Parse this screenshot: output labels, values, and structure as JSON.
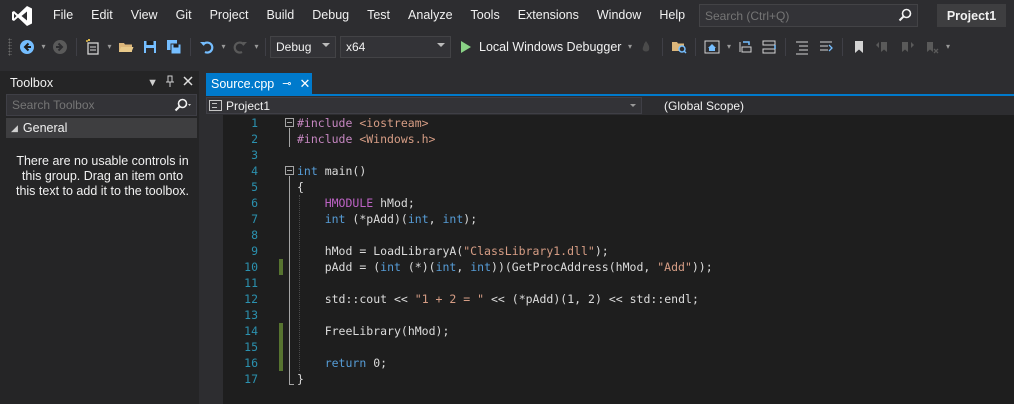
{
  "menu": {
    "items": [
      "File",
      "Edit",
      "View",
      "Git",
      "Project",
      "Build",
      "Debug",
      "Test",
      "Analyze",
      "Tools",
      "Extensions",
      "Window",
      "Help"
    ],
    "search_placeholder": "Search (Ctrl+Q)",
    "project_name": "Project1"
  },
  "toolbar": {
    "configuration": "Debug",
    "platform": "x64",
    "debugger_label": "Local Windows Debugger"
  },
  "toolbox": {
    "title": "Toolbox",
    "search_placeholder": "Search Toolbox",
    "group": "General",
    "empty_message": "There are no usable controls in this group. Drag an item onto this text to add it to the toolbox."
  },
  "editor": {
    "tab_label": "Source.cpp",
    "nav_project": "Project1",
    "nav_scope": "(Global Scope)",
    "line_numbers": [
      "1",
      "2",
      "3",
      "4",
      "5",
      "6",
      "7",
      "8",
      "9",
      "10",
      "11",
      "12",
      "13",
      "14",
      "15",
      "16",
      "17"
    ],
    "lines": [
      "#include <iostream>",
      "#include <Windows.h>",
      "",
      "int main()",
      "{",
      "    HMODULE hMod;",
      "    int (*pAdd)(int, int);",
      "",
      "    hMod = LoadLibraryA(\"ClassLibrary1.dll\");",
      "    pAdd = (int (*)(int, int))(GetProcAddress(hMod, \"Add\"));",
      "",
      "    std::cout << \"1 + 2 = \" << (*pAdd)(1, 2) << std::endl;",
      "",
      "    FreeLibrary(hMod);",
      "",
      "    return 0;",
      "}"
    ]
  },
  "colors": {
    "accent": "#007acc",
    "editor_bg": "#1e1e1e",
    "chrome_bg": "#2d2d30",
    "line_number": "#2b91af",
    "keyword": "#569cd6",
    "change_marker": "#577430"
  }
}
